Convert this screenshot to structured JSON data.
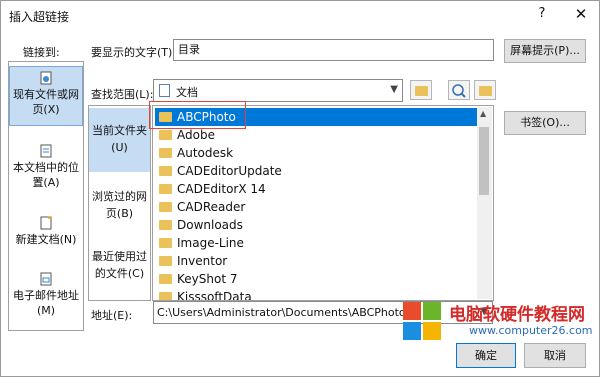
{
  "dialog": {
    "title": "插入超链接",
    "help": "?",
    "close": "✕"
  },
  "link_to": {
    "label": "链接到:",
    "items": [
      {
        "label": "现有文件或网页(X)",
        "icon": "globe-file-icon",
        "selected": true
      },
      {
        "label": "本文档中的位置(A)",
        "icon": "document-place-icon"
      },
      {
        "label": "新建文档(N)",
        "icon": "new-document-icon"
      },
      {
        "label": "电子邮件地址(M)",
        "icon": "email-icon"
      }
    ]
  },
  "display_text": {
    "label": "要显示的文字(T):",
    "value": "目录"
  },
  "screentip_button": "屏幕提示(P)...",
  "look_in": {
    "label": "查找范围(L):",
    "value": "文档"
  },
  "subnav": {
    "current_folder": "当前文件夹(U)",
    "browsed_pages": "浏览过的网页(B)",
    "recent_files": "最近使用过的文件(C)"
  },
  "files": [
    {
      "name": "ABCPhoto",
      "selected": true
    },
    {
      "name": "Adobe"
    },
    {
      "name": "Autodesk"
    },
    {
      "name": "CADEditorUpdate"
    },
    {
      "name": "CADEditorX 14"
    },
    {
      "name": "CADReader"
    },
    {
      "name": "Downloads"
    },
    {
      "name": "Image-Line"
    },
    {
      "name": "Inventor"
    },
    {
      "name": "KeyShot 7"
    },
    {
      "name": "KisssoftData"
    }
  ],
  "bookmark_button": "书签(O)...",
  "address": {
    "label": "地址(E):",
    "value": "C:\\Users\\Administrator\\Documents\\ABCPhoto"
  },
  "ok_button": "确定",
  "cancel_button": "取消",
  "watermark": {
    "text": "电脑软硬件教程网",
    "url": "www.computer26.com",
    "colors": {
      "red": "#e94b2d",
      "green": "#6bb52b",
      "blue": "#1c8ee0",
      "yellow": "#f5b400"
    }
  }
}
